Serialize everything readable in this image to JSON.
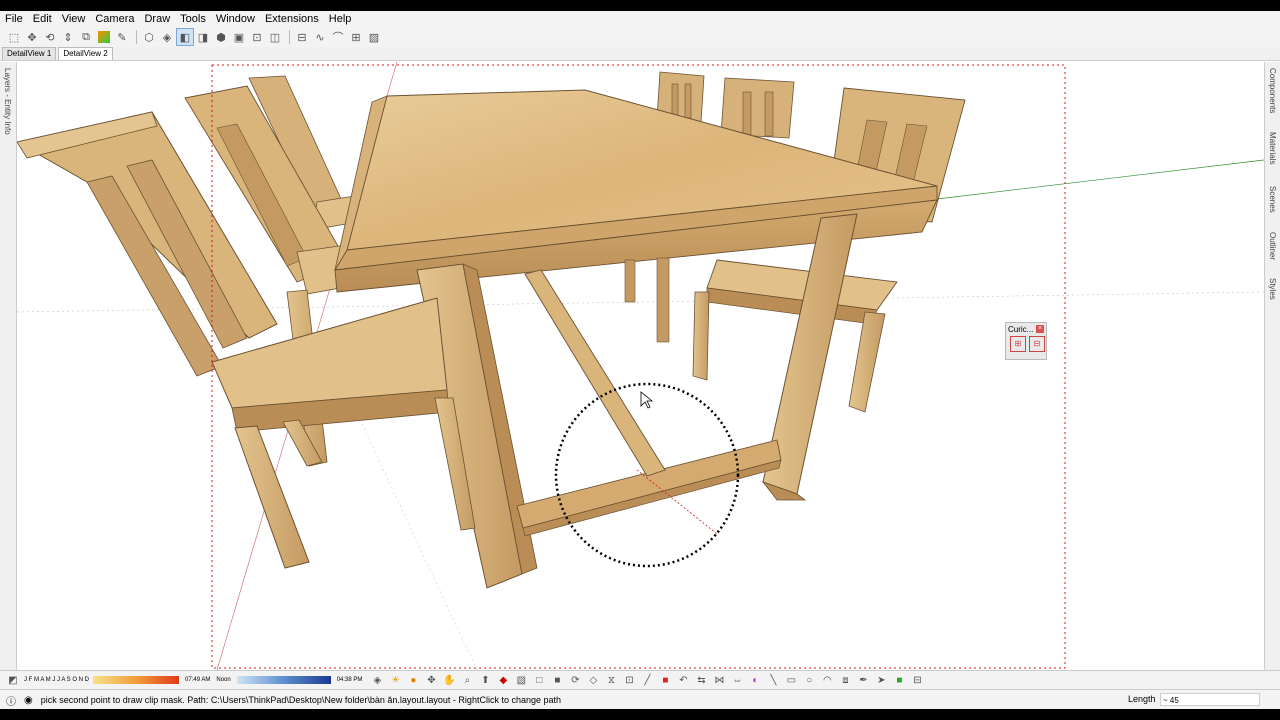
{
  "menu": [
    "File",
    "Edit",
    "View",
    "Camera",
    "Draw",
    "Tools",
    "Window",
    "Extensions",
    "Help"
  ],
  "tabs": [
    {
      "label": "DetailView 1"
    },
    {
      "label": "DetailView 2"
    }
  ],
  "left_panel": {
    "label": "Layers - Entity Info"
  },
  "right_panel": {
    "items": [
      "Components",
      "Materials",
      "Scenes",
      "Outliner",
      "Styles"
    ]
  },
  "floating_toolbar": {
    "title": "Curic..."
  },
  "bottom_toolbar": {
    "months": "J F M A M J J A S O N D",
    "time_start": "07:49 AM",
    "time_mid": "Noon",
    "time_end": "04:38 PM"
  },
  "status": {
    "message": "pick second point to draw clip mask. Path: C:\\Users\\ThinkPad\\Desktop\\New folder\\bàn ăn.layout.layout - RightClick to change path",
    "length_label": "Length",
    "length_value": "~ 45"
  },
  "colors": {
    "wood": "#d9b57c",
    "wood_dark": "#b98d55",
    "wood_light": "#e9cc98",
    "selection_red": "#d01818",
    "axis_green": "#2a8a2a"
  }
}
